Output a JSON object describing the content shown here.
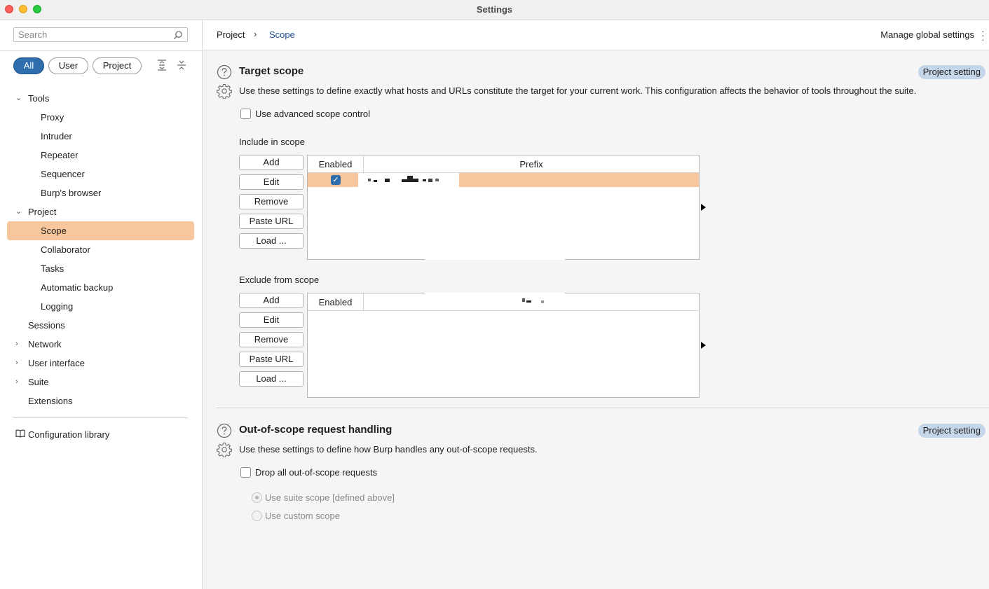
{
  "window": {
    "title": "Settings"
  },
  "sidebar": {
    "search_placeholder": "Search",
    "filters": {
      "all": "All",
      "user": "User",
      "project": "Project"
    },
    "tree": {
      "tools": "Tools",
      "proxy": "Proxy",
      "intruder": "Intruder",
      "repeater": "Repeater",
      "sequencer": "Sequencer",
      "burps_browser": "Burp's browser",
      "project": "Project",
      "scope": "Scope",
      "collaborator": "Collaborator",
      "tasks": "Tasks",
      "automatic_backup": "Automatic backup",
      "logging": "Logging",
      "sessions": "Sessions",
      "network": "Network",
      "user_interface": "User interface",
      "suite": "Suite",
      "extensions": "Extensions"
    },
    "config_library": "Configuration library"
  },
  "breadcrumb": {
    "project": "Project",
    "scope": "Scope"
  },
  "header": {
    "manage_global": "Manage global settings"
  },
  "target_scope": {
    "title": "Target scope",
    "badge": "Project setting",
    "description": "Use these settings to define exactly what hosts and URLs constitute the target for your current work. This configuration affects the behavior of tools throughout the suite.",
    "advanced_label": "Use advanced scope control",
    "advanced_checked": false,
    "include": {
      "label": "Include in scope",
      "buttons": {
        "add": "Add",
        "edit": "Edit",
        "remove": "Remove",
        "paste_url": "Paste URL",
        "load": "Load ..."
      },
      "columns": {
        "enabled": "Enabled",
        "prefix": "Prefix"
      },
      "rows": [
        {
          "enabled": true
        }
      ]
    },
    "exclude": {
      "label": "Exclude from scope",
      "buttons": {
        "add": "Add",
        "edit": "Edit",
        "remove": "Remove",
        "paste_url": "Paste URL",
        "load": "Load ..."
      },
      "columns": {
        "enabled": "Enabled"
      },
      "rows": []
    }
  },
  "out_of_scope": {
    "title": "Out-of-scope request handling",
    "badge": "Project setting",
    "description": "Use these settings to define how Burp handles any out-of-scope requests.",
    "drop_label": "Drop all out-of-scope requests",
    "drop_checked": false,
    "radio_suite": "Use suite scope [defined above]",
    "radio_custom": "Use custom scope"
  },
  "colors": {
    "accent": "#2e6ead",
    "selection": "#f8c69c",
    "badge": "#c5d6ea"
  }
}
